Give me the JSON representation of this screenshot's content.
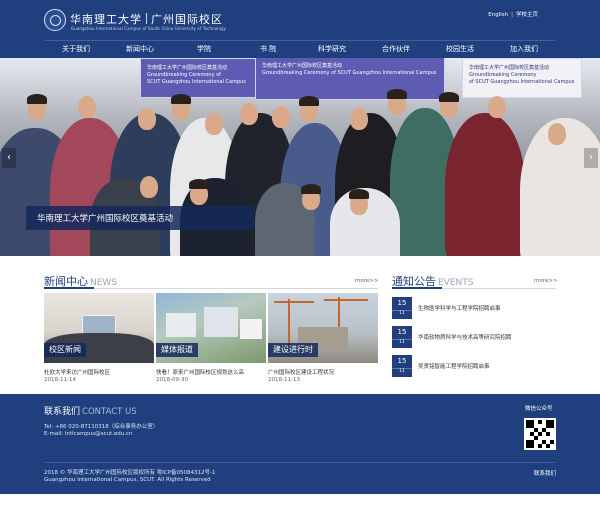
{
  "header": {
    "logo_cn_school": "华南理工大学",
    "logo_cn_campus": "广州国际校区",
    "logo_en": "Guangzhou International Campus of South China University of Technology",
    "top_links": [
      "English",
      "学校主页"
    ]
  },
  "nav": [
    "关于我们",
    "新闻中心",
    "学院",
    "书 院",
    "科学研究",
    "合作伙伴",
    "校园生活",
    "加入我们"
  ],
  "banner": {
    "caption": "华南理工大学广州国际校区奠基活动",
    "board_left": "华南理工大学广州国际校区奠基活动\nGroundbreaking Ceremony of\nSCUT Guangzhou International Campus",
    "board_center": "华南理工大学广州国际校区奠基活动\nGroundbreaking Ceremony of SCUT Guangzhou International Campus",
    "board_right": "华南理工大学广州国际校区奠基活动\nGroundbreaking Ceremony\nof SCUT Guangzhou International Campus"
  },
  "news": {
    "title": "新闻中心",
    "title_en": "NEWS",
    "more": "more>>",
    "items": [
      {
        "label": "校区新闻",
        "caption": "杜欧大学来访广州国际校区",
        "date": "2018-11-14"
      },
      {
        "label": "媒体报道",
        "caption": "快看！原来广州国际校区规划这么高",
        "date": "2018-09-30"
      },
      {
        "label": "建设进行时",
        "caption": "广州国际校区建设工程状况",
        "date": "2018-11-13"
      }
    ]
  },
  "notices": {
    "title": "通知公告",
    "title_en": "EVENTS",
    "more": "more>>",
    "items": [
      {
        "day": "15",
        "month": "11",
        "text": "生物医学科学与工程学院招聘启事"
      },
      {
        "day": "15",
        "month": "11",
        "text": "华南软物质科学与技术高等研究院招聘"
      },
      {
        "day": "15",
        "month": "11",
        "text": "吴贤铭智能工程学院招聘启事"
      }
    ]
  },
  "footer": {
    "contact_title": "联系我们",
    "contact_title_en": "CONTACT US",
    "tel": "Tel: +86 020-87110318（综合事务办公室）",
    "email": "E-mail: intlcampus@scut.edu.cn",
    "wechat": "微信公众号",
    "copyright_cn": "2018 © 华南理工大学广州国际校区版权所有 粤ICP备05084312号-1",
    "copyright_en": "Guangzhou International Campus, SCUT. All Rights Reserved",
    "contact_link": "联系我们"
  },
  "colors": {
    "brand": "#1f3f7e",
    "caption_bg": "#14285a"
  }
}
